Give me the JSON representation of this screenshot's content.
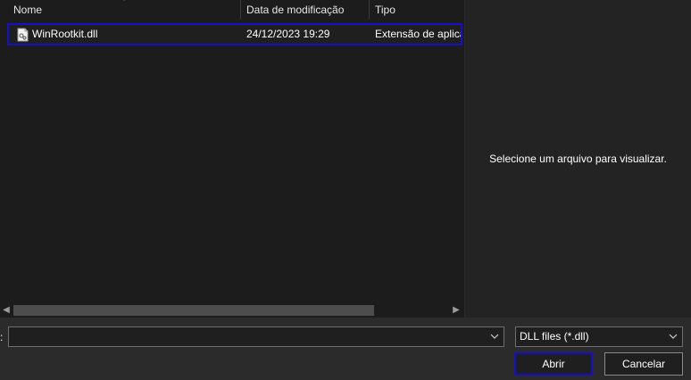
{
  "columns": {
    "name": "Nome",
    "modified": "Data de modificação",
    "type": "Tipo"
  },
  "files": [
    {
      "name": "WinRootkit.dll",
      "modified": "24/12/2023 19:29",
      "type": "Extensão de aplica",
      "icon": "dll-file-icon",
      "selected": true
    }
  ],
  "preview": {
    "message": "Selecione um arquivo para visualizar."
  },
  "footer": {
    "filename_label_tail": ":",
    "filename_value": "",
    "file_type_value": "DLL files (*.dll)",
    "open_label": "Abrir",
    "cancel_label": "Cancelar"
  },
  "colors": {
    "selection_border": "#1410c8",
    "background": "#202020"
  }
}
